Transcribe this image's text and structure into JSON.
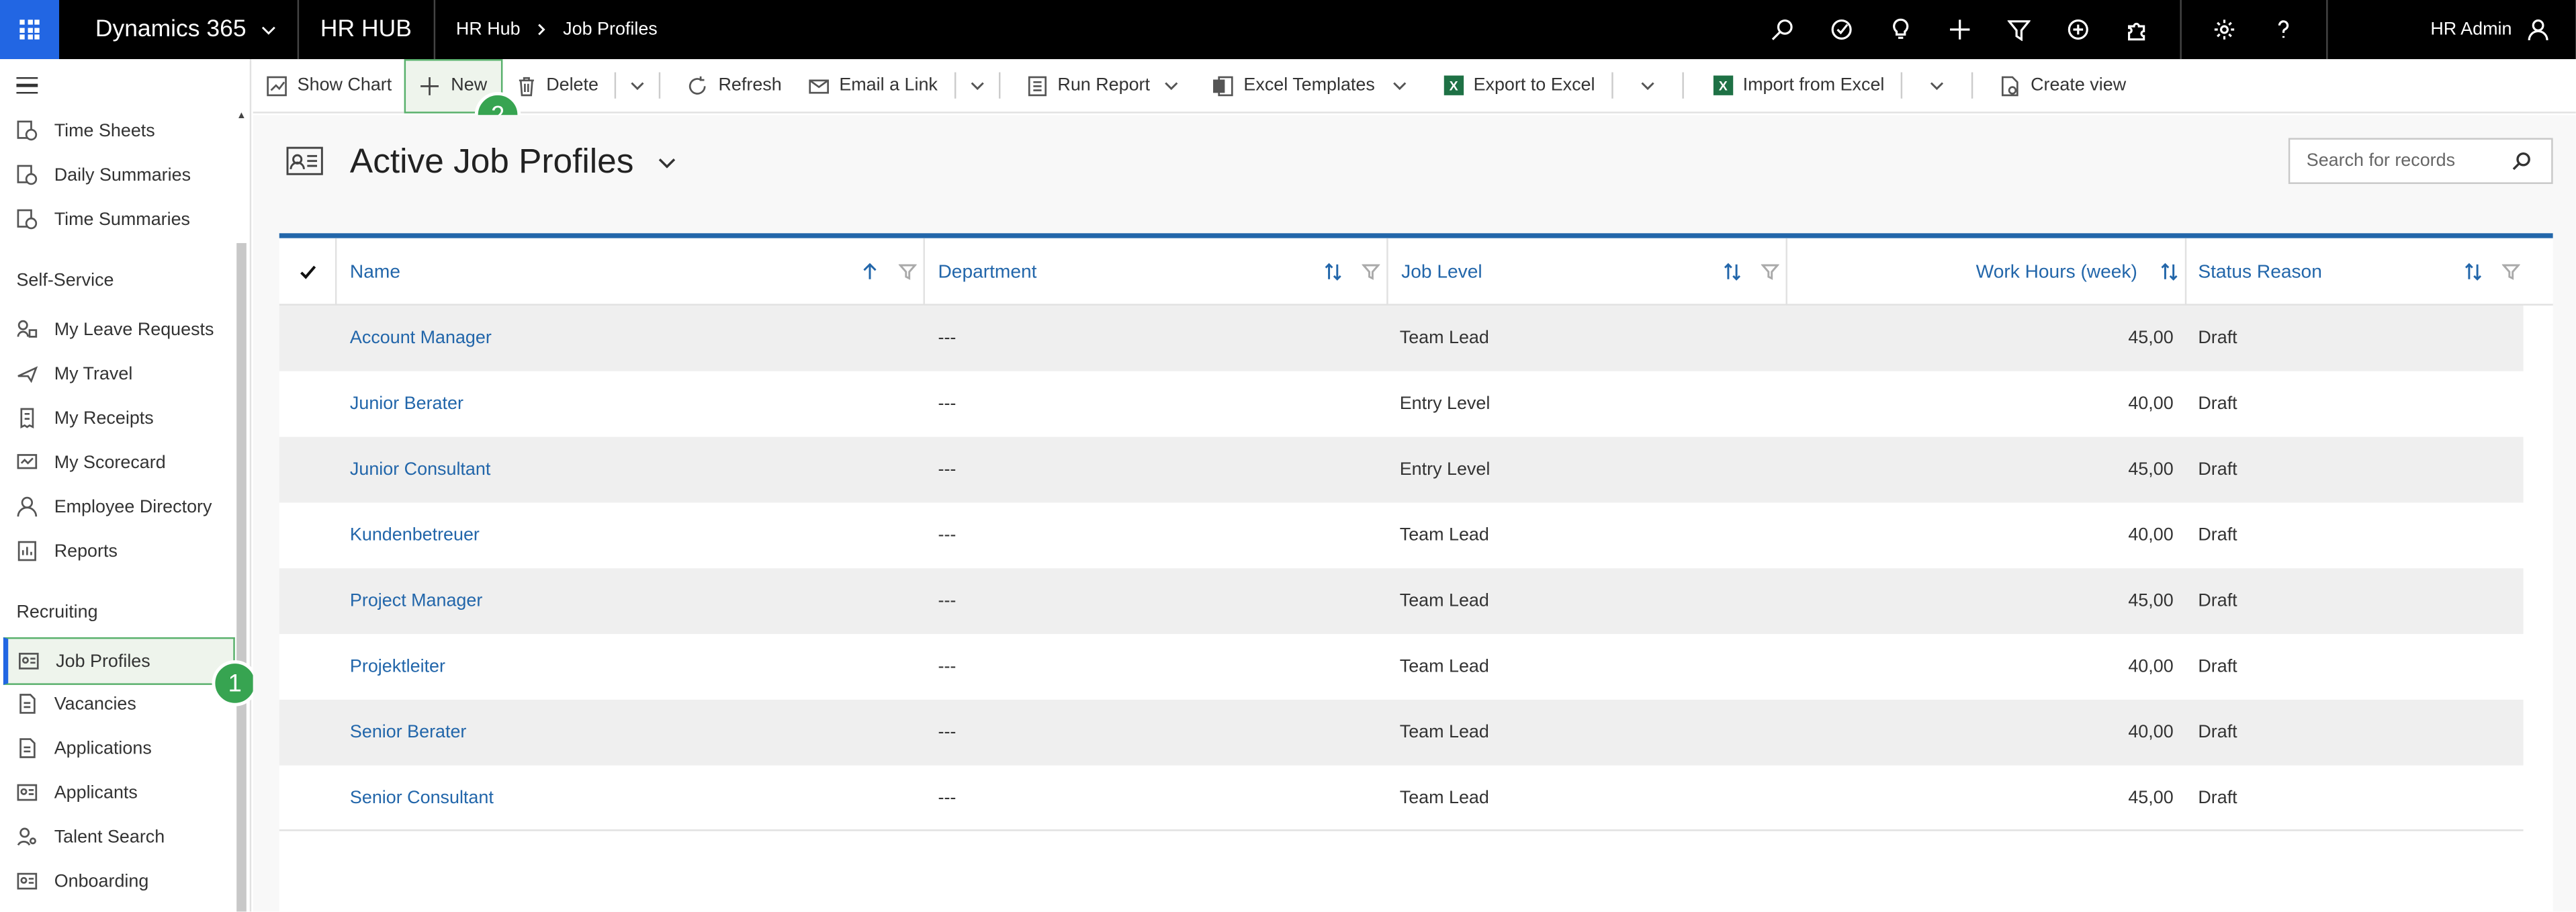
{
  "topbar": {
    "app_name": "Dynamics 365",
    "hub": "HR HUB",
    "breadcrumb": [
      "HR Hub",
      "Job Profiles"
    ],
    "user": "HR Admin",
    "icons": [
      "search-icon",
      "task-icon",
      "lightbulb-icon",
      "plus-icon",
      "filter-icon",
      "add-circle-icon",
      "puzzle-icon",
      "gear-icon",
      "help-icon",
      "user-icon"
    ]
  },
  "sidebar": {
    "groups": [
      {
        "title": "",
        "items": [
          {
            "label": "Time Sheets",
            "icon": "time-sheet-icon"
          },
          {
            "label": "Daily Summaries",
            "icon": "time-sheet-icon"
          },
          {
            "label": "Time Summaries",
            "icon": "time-sheet-icon"
          }
        ]
      },
      {
        "title": "Self-Service",
        "items": [
          {
            "label": "My Leave Requests",
            "icon": "leave-icon"
          },
          {
            "label": "My Travel",
            "icon": "travel-icon"
          },
          {
            "label": "My Receipts",
            "icon": "receipt-icon"
          },
          {
            "label": "My Scorecard",
            "icon": "scorecard-icon"
          },
          {
            "label": "Employee Directory",
            "icon": "person-icon"
          },
          {
            "label": "Reports",
            "icon": "report-icon"
          }
        ]
      },
      {
        "title": "Recruiting",
        "items": [
          {
            "label": "Job Profiles",
            "icon": "id-card-icon",
            "active": true
          },
          {
            "label": "Vacancies",
            "icon": "document-icon"
          },
          {
            "label": "Applications",
            "icon": "document-icon"
          },
          {
            "label": "Applicants",
            "icon": "id-card-icon"
          },
          {
            "label": "Talent Search",
            "icon": "person-search-icon"
          },
          {
            "label": "Onboarding",
            "icon": "id-card-icon"
          }
        ]
      }
    ],
    "badge1": "1"
  },
  "commandbar": {
    "show_chart": "Show Chart",
    "new": "New",
    "delete": "Delete",
    "refresh": "Refresh",
    "email_link": "Email a Link",
    "run_report": "Run Report",
    "excel_templates": "Excel Templates",
    "export_excel": "Export to Excel",
    "import_excel": "Import from Excel",
    "create_view": "Create view",
    "badge2": "2"
  },
  "view": {
    "title": "Active Job Profiles",
    "search_placeholder": "Search for records"
  },
  "grid": {
    "columns": [
      "Name",
      "Department",
      "Job Level",
      "Work Hours (week)",
      "Status Reason"
    ],
    "rows": [
      {
        "name": "Account Manager",
        "department": "---",
        "level": "Team Lead",
        "hours": "45,00",
        "status": "Draft"
      },
      {
        "name": "Junior Berater",
        "department": "---",
        "level": "Entry Level",
        "hours": "40,00",
        "status": "Draft"
      },
      {
        "name": "Junior Consultant",
        "department": "---",
        "level": "Entry Level",
        "hours": "45,00",
        "status": "Draft"
      },
      {
        "name": "Kundenbetreuer",
        "department": "---",
        "level": "Team Lead",
        "hours": "40,00",
        "status": "Draft"
      },
      {
        "name": "Project Manager",
        "department": "---",
        "level": "Team Lead",
        "hours": "45,00",
        "status": "Draft"
      },
      {
        "name": "Projektleiter",
        "department": "---",
        "level": "Team Lead",
        "hours": "40,00",
        "status": "Draft"
      },
      {
        "name": "Senior Berater",
        "department": "---",
        "level": "Team Lead",
        "hours": "40,00",
        "status": "Draft"
      },
      {
        "name": "Senior Consultant",
        "department": "---",
        "level": "Team Lead",
        "hours": "45,00",
        "status": "Draft"
      }
    ]
  },
  "colors": {
    "accent": "#2266aa",
    "highlight": "#37a451",
    "topbar": "#000000",
    "waffle": "#2266e3"
  }
}
